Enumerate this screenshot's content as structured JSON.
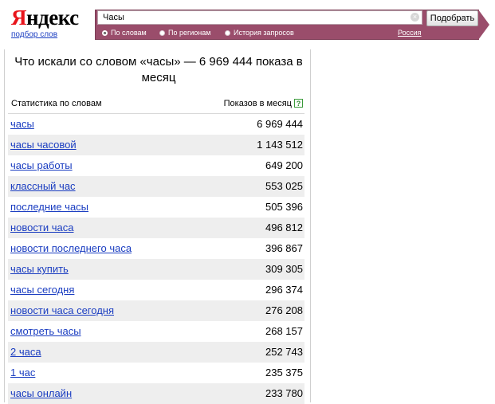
{
  "logo": {
    "word_first": "Я",
    "word_rest": "ндекс",
    "subtitle": "подбор слов"
  },
  "search": {
    "value": "Часы",
    "clear": "×",
    "submit_label": "Подобрать"
  },
  "radios": [
    {
      "label": "По словам",
      "selected": true
    },
    {
      "label": "По регионам",
      "selected": false
    },
    {
      "label": "История запросов",
      "selected": false
    }
  ],
  "region": "Россия",
  "headline": "Что искали со словом «часы» — 6 969 444 показа в месяц",
  "table": {
    "col_left": "Статистика по словам",
    "col_right": "Показов в месяц",
    "help": "?",
    "rows": [
      {
        "phrase": "часы",
        "count": "6 969 444"
      },
      {
        "phrase": "часы часовой",
        "count": "1 143 512"
      },
      {
        "phrase": "часы работы",
        "count": "649 200"
      },
      {
        "phrase": "классный час",
        "count": "553 025"
      },
      {
        "phrase": "последние часы",
        "count": "505 396"
      },
      {
        "phrase": "новости часа",
        "count": "496 812"
      },
      {
        "phrase": "новости последнего часа",
        "count": "396 867"
      },
      {
        "phrase": "часы купить",
        "count": "309 305"
      },
      {
        "phrase": "часы сегодня",
        "count": "296 374"
      },
      {
        "phrase": "новости часа сегодня",
        "count": "276 208"
      },
      {
        "phrase": "смотреть часы",
        "count": "268 157"
      },
      {
        "phrase": "2 часа",
        "count": "252 743"
      },
      {
        "phrase": "1 час",
        "count": "235 375"
      },
      {
        "phrase": "часы онлайн",
        "count": "233 780"
      }
    ]
  },
  "colors": {
    "band": "#9a4d6b",
    "link": "#1a3dc1",
    "logo_red": "#e8141b"
  }
}
